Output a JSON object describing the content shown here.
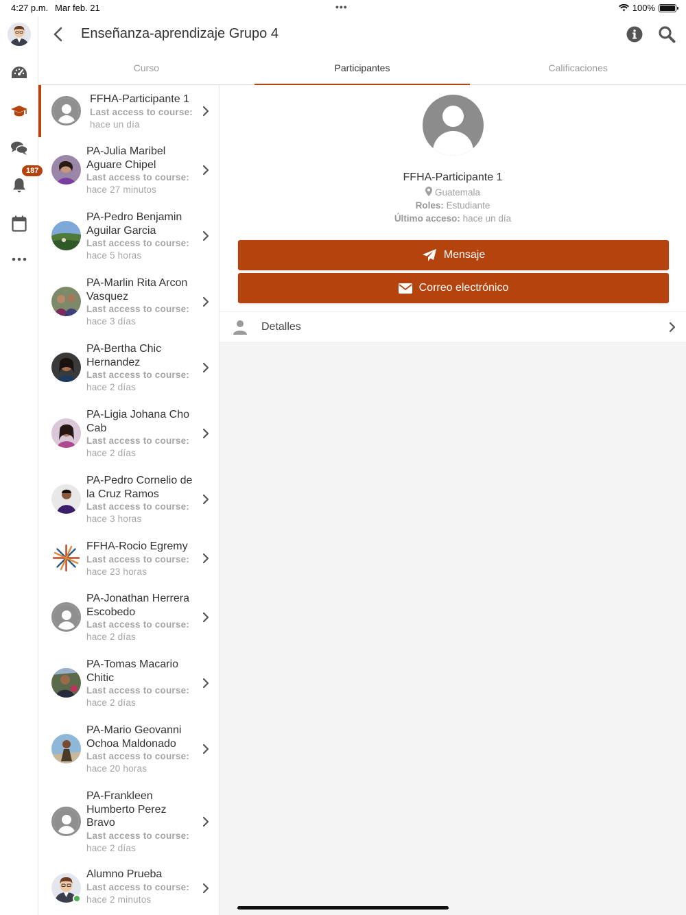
{
  "status_bar": {
    "time": "4:27 p.m.",
    "date": "Mar feb. 21",
    "battery": "100%"
  },
  "rail": {
    "notifications_count": "187"
  },
  "header": {
    "title": "Enseñanza-aprendizaje Grupo 4"
  },
  "tabs": [
    {
      "label": "Curso"
    },
    {
      "label": "Participantes"
    },
    {
      "label": "Calificaciones"
    }
  ],
  "participants": [
    {
      "name": "FFHA-Participante 1",
      "label": "Last access to course:",
      "value": "hace un día"
    },
    {
      "name": "PA-Julia Maribel Aguare Chipel",
      "label": "Last access to course:",
      "value": "hace 27 minutos"
    },
    {
      "name": "PA-Pedro Benjamin Aguilar Garcia",
      "label": "Last access to course:",
      "value": "hace 5 horas"
    },
    {
      "name": "PA-Marlin Rita Arcon Vasquez",
      "label": "Last access to course:",
      "value": "hace 3 días"
    },
    {
      "name": "PA-Bertha Chic Hernandez",
      "label": "Last access to course:",
      "value": "hace 2 días"
    },
    {
      "name": "PA-Ligia Johana Cho Cab",
      "label": "Last access to course:",
      "value": "hace 2 días"
    },
    {
      "name": "PA-Pedro Cornelio de la Cruz Ramos",
      "label": "Last access to course:",
      "value": "hace 3 horas"
    },
    {
      "name": "FFHA-Rocio Egremy",
      "label": "Last access to course:",
      "value": "hace 23 horas"
    },
    {
      "name": "PA-Jonathan Herrera Escobedo",
      "label": "Last access to course:",
      "value": "hace 2 días"
    },
    {
      "name": "PA-Tomas Macario Chitic",
      "label": "Last access to course:",
      "value": "hace 2 días"
    },
    {
      "name": "PA-Mario Geovanni Ochoa Maldonado",
      "label": "Last access to course:",
      "value": "hace 20 horas"
    },
    {
      "name": "PA-Frankleen Humberto Perez Bravo",
      "label": "Last access to course:",
      "value": "hace 2 días"
    },
    {
      "name": "Alumno Prueba",
      "label": "Last access to course:",
      "value": "hace 2 minutos"
    }
  ],
  "detail": {
    "name": "FFHA-Participante 1",
    "location": "Guatemala",
    "roles_label": "Roles:",
    "roles_value": "Estudiante",
    "last_access_label": "Último acceso:",
    "last_access_value": "hace un día",
    "message_button": "Mensaje",
    "email_button": "Correo electrónico",
    "details_label": "Detalles"
  },
  "colors": {
    "accent": "#b5430e",
    "muted": "#a5a5a5"
  }
}
